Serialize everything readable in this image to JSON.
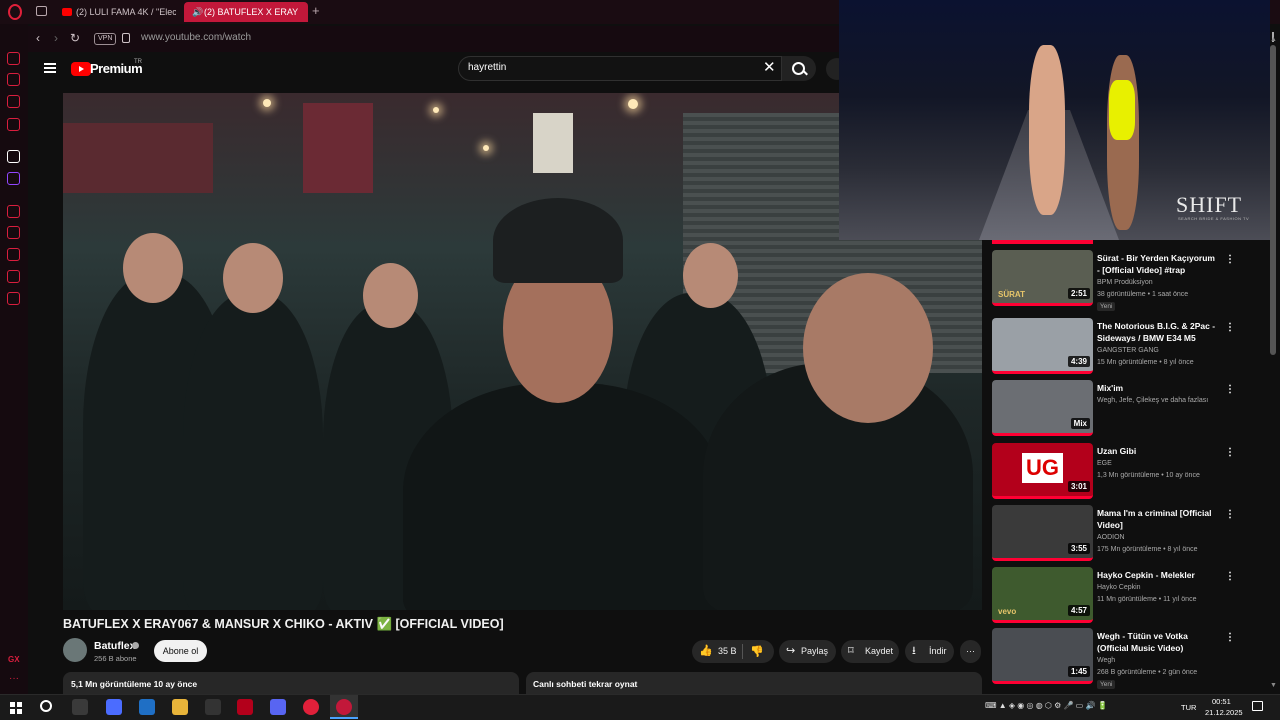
{
  "browser": {
    "tabs": [
      {
        "label": "(2) LULI FAMA 4K / \"Elect"
      },
      {
        "label": "(2) BATUFLEX X ERAY",
        "active": true
      }
    ],
    "new_tab": "+",
    "vpn_badge": "VPN",
    "url": "www.youtube.com/watch",
    "nav": {
      "back": "‹",
      "forward": "›",
      "reload": "↻"
    }
  },
  "sidebar": {
    "icons": [
      "messenger-icon",
      "instagram-icon",
      "whatsapp-icon",
      "vk-icon",
      "tiktok-icon",
      "twitch-icon",
      "player-icon",
      "pin-icon",
      "history-icon",
      "extensions-icon",
      "settings-icon"
    ],
    "gx_label": "GX",
    "more": "···",
    "accent": "#d91e3e"
  },
  "youtube": {
    "brand": "Premium",
    "brand_region": "TR",
    "search_value": "hayrettin",
    "video": {
      "title": "BATUFLEX X ERAY067 & MANSUR X CHIKO - AKTIV ✅ [OFFICIAL VIDEO]",
      "channel": "Batuflex",
      "subscribers": "256 B abone",
      "subscribe_label": "Abone ol",
      "likes": "35 B",
      "share_label": "Paylaş",
      "save_label": "Kaydet",
      "download_label": "İndir",
      "more_label": "···",
      "desc_summary": "5,1 Mn görüntüleme  10 ay önce",
      "chat_replay": "Canlı sohbeti tekrar oynat"
    },
    "recommendations": [
      {
        "title": "Sürat - Bir Yerden Kaçıyorum - [Official Video] #trap",
        "channel": "BPM Prodüksiyon",
        "meta": "38 görüntüleme • 1 saat önce",
        "badge": "Yeni",
        "duration": "2:51",
        "thumb_text": "SÜRAT",
        "thumb_color": "#5a5e52"
      },
      {
        "title": "The Notorious B.I.G. & 2Pac - Sideways / BMW E34 M5 Illeg...",
        "channel": "GANGSTER GANG",
        "meta": "15 Mn görüntüleme • 8 yıl önce",
        "duration": "4:39",
        "thumb_color": "#9aa0a6"
      },
      {
        "title": "Mix'im",
        "channel": "Wegh, Jefe, Çilekeş ve daha fazlası",
        "meta": "",
        "duration": "Mix",
        "thumb_color": "#6b6e73"
      },
      {
        "title": "Uzan Gibi",
        "channel": "EGE",
        "meta": "1,3 Mn görüntüleme • 10 ay önce",
        "duration": "3:01",
        "thumb_text": "UG",
        "thumb_color": "#b3001b"
      },
      {
        "title": "Mama I'm a criminal [Official Video]",
        "channel": "AODION",
        "meta": "175 Mn görüntüleme • 8 yıl önce",
        "duration": "3:55",
        "thumb_color": "#3a3a3a"
      },
      {
        "title": "Hayko Cepkin - Melekler",
        "channel": "Hayko Cepkin",
        "meta": "11 Mn görüntüleme • 11 yıl önce",
        "duration": "4:57",
        "thumb_text": "vevo",
        "thumb_color": "#3e5a2e"
      },
      {
        "title": "Wegh - Tütün ve Votka (Official Music Video)",
        "channel": "Wegh",
        "meta": "268 B görüntüleme • 2 gün önce",
        "badge": "Yeni",
        "duration": "1:45",
        "thumb_color": "#4a4d52"
      }
    ]
  },
  "overlay": {
    "logo": "SHIFT",
    "sub": "SEARCH BRIDE & FASHION TV"
  },
  "taskbar": {
    "apps": [
      "task-view-icon",
      "copilot-icon",
      "mail-icon",
      "file-explorer-icon",
      "obs-icon",
      "video-editor-icon",
      "discord-icon",
      "opera-icon",
      "opera-gx-icon"
    ],
    "language": "TUR",
    "time": "00:51",
    "date": "21.12.2025"
  }
}
